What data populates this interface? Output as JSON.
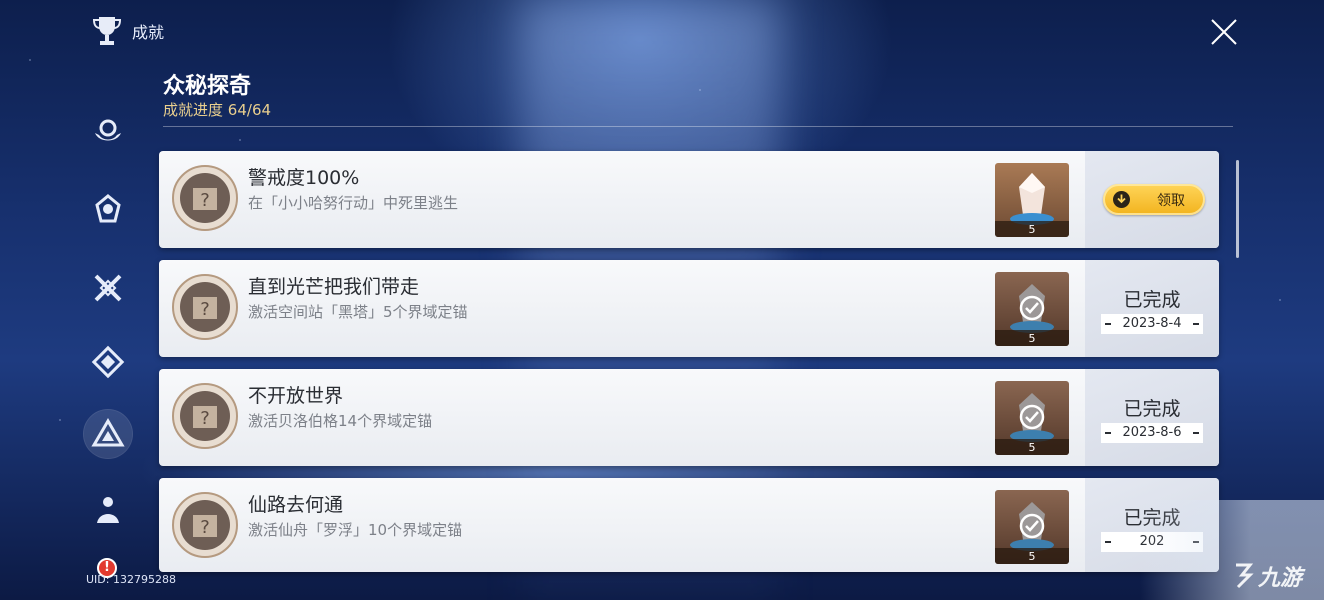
{
  "header": {
    "title": "成就",
    "trophy_icon": "trophy-icon",
    "close_icon": "close-icon"
  },
  "category": {
    "title": "众秘探奇",
    "progress_label": "成就进度",
    "progress_value": "64/64"
  },
  "sidebar": {
    "items": [
      {
        "icon": "hands-emblem-icon",
        "active": false
      },
      {
        "icon": "helmet-emblem-icon",
        "active": false
      },
      {
        "icon": "crossed-swords-emblem-icon",
        "active": false
      },
      {
        "icon": "diamond-emblem-icon",
        "active": false
      },
      {
        "icon": "triangle-emblem-icon",
        "active": true
      },
      {
        "icon": "figure-emblem-icon",
        "active": false
      }
    ],
    "uid": "UID: 132795288",
    "alert": "!"
  },
  "achievements": [
    {
      "title": "警戒度100%",
      "desc": "在「小小哈努行动」中死里逃生",
      "reward_qty": "5",
      "status": "claim",
      "claim_label": "领取"
    },
    {
      "title": "直到光芒把我们带走",
      "desc": "激活空间站「黑塔」5个界域定锚",
      "reward_qty": "5",
      "status": "done",
      "done_label": "已完成",
      "date": "2023-8-4"
    },
    {
      "title": "不开放世界",
      "desc": "激活贝洛伯格14个界域定锚",
      "reward_qty": "5",
      "status": "done",
      "done_label": "已完成",
      "date": "2023-8-6"
    },
    {
      "title": "仙路去何通",
      "desc": "激活仙舟「罗浮」10个界域定锚",
      "reward_qty": "5",
      "status": "done",
      "done_label": "已完成",
      "date": "202"
    }
  ],
  "watermark": {
    "text": "九游"
  },
  "colors": {
    "accent_gold": "#f2b31d",
    "progress_gold": "#e9cf8e",
    "card_bg": "#f8f9fb"
  }
}
